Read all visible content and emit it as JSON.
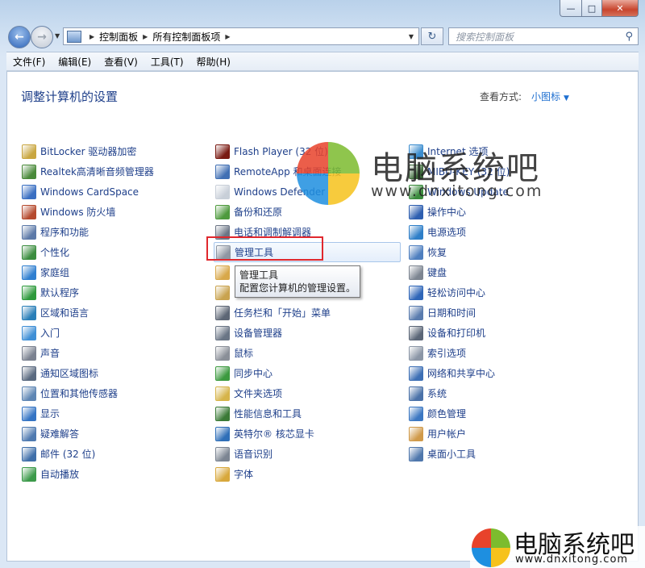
{
  "nav": {
    "address": [
      "控制面板",
      "所有控制面板项"
    ],
    "search_placeholder": "搜索控制面板"
  },
  "menu": [
    "文件(F)",
    "编辑(E)",
    "查看(V)",
    "工具(T)",
    "帮助(H)"
  ],
  "header": {
    "title": "调整计算机的设置",
    "view_by_label": "查看方式:",
    "view_by_value": "小图标"
  },
  "columns": [
    [
      {
        "label": "BitLocker 驱动器加密",
        "icon": "bitlocker-icon",
        "color": "#c9a640"
      },
      {
        "label": "Realtek高清晰音频管理器",
        "icon": "realtek-audio-icon",
        "color": "#4a8a3a"
      },
      {
        "label": "Windows CardSpace",
        "icon": "cardspace-icon",
        "color": "#3a6fc2"
      },
      {
        "label": "Windows 防火墙",
        "icon": "firewall-icon",
        "color": "#b54a2e"
      },
      {
        "label": "程序和功能",
        "icon": "programs-icon",
        "color": "#5d7aa8"
      },
      {
        "label": "个性化",
        "icon": "personalization-icon",
        "color": "#3b8d3f"
      },
      {
        "label": "家庭组",
        "icon": "homegroup-icon",
        "color": "#2f7fd0"
      },
      {
        "label": "默认程序",
        "icon": "default-programs-icon",
        "color": "#2e9a3c"
      },
      {
        "label": "区域和语言",
        "icon": "region-language-icon",
        "color": "#2a7fb8"
      },
      {
        "label": "入门",
        "icon": "getting-started-icon",
        "color": "#3f8fd6"
      },
      {
        "label": "声音",
        "icon": "sound-icon",
        "color": "#7b8290"
      },
      {
        "label": "通知区域图标",
        "icon": "notification-icon",
        "color": "#5a6a80"
      },
      {
        "label": "位置和其他传感器",
        "icon": "location-sensors-icon",
        "color": "#5e86b4"
      },
      {
        "label": "显示",
        "icon": "display-icon",
        "color": "#3474c4"
      },
      {
        "label": "疑难解答",
        "icon": "troubleshooting-icon",
        "color": "#4f7ab0"
      },
      {
        "label": "邮件 (32 位)",
        "icon": "mail-icon",
        "color": "#3f6fa9"
      },
      {
        "label": "自动播放",
        "icon": "autoplay-icon",
        "color": "#3c9a4a"
      }
    ],
    [
      {
        "label": "Flash Player (32 位)",
        "icon": "flash-icon",
        "color": "#7a1a12"
      },
      {
        "label": "RemoteApp 和桌面连接",
        "icon": "remoteapp-icon",
        "color": "#4170b4"
      },
      {
        "label": "Windows Defender",
        "icon": "defender-icon",
        "color": "#c8cfd8"
      },
      {
        "label": "备份和还原",
        "icon": "backup-icon",
        "color": "#4e9a3d"
      },
      {
        "label": "电话和调制解调器",
        "icon": "phone-modem-icon",
        "color": "#6b7585"
      },
      {
        "label": "管理工具",
        "icon": "admin-tools-icon",
        "color": "#8e96a2"
      },
      {
        "label": "",
        "icon": "hidden-item-icon",
        "color": "#d8a84a"
      },
      {
        "label": "",
        "icon": "hidden-item-icon-2",
        "color": "#c9a34f"
      },
      {
        "label": "任务栏和「开始」菜单",
        "icon": "taskbar-icon",
        "color": "#5d6675"
      },
      {
        "label": "设备管理器",
        "icon": "device-manager-icon",
        "color": "#6a7585"
      },
      {
        "label": "鼠标",
        "icon": "mouse-icon",
        "color": "#8a8f98"
      },
      {
        "label": "同步中心",
        "icon": "sync-center-icon",
        "color": "#3c9a3f"
      },
      {
        "label": "文件夹选项",
        "icon": "folder-options-icon",
        "color": "#d6b44a"
      },
      {
        "label": "性能信息和工具",
        "icon": "performance-icon",
        "color": "#3a7a36"
      },
      {
        "label": "英特尔® 核芯显卡",
        "icon": "intel-graphics-icon",
        "color": "#2f6fb8"
      },
      {
        "label": "语音识别",
        "icon": "speech-icon",
        "color": "#7c8592"
      },
      {
        "label": "字体",
        "icon": "fonts-icon",
        "color": "#d8a83c"
      }
    ],
    [
      {
        "label": "Internet 选项",
        "icon": "internet-options-icon",
        "color": "#3a8ccf"
      },
      {
        "label": "MIBU-KEY (32 位)",
        "icon": "mibu-key-icon",
        "color": "#3d6b3a"
      },
      {
        "label": "Windows Update",
        "icon": "windows-update-icon",
        "color": "#3b8c3d"
      },
      {
        "label": "操作中心",
        "icon": "action-center-icon",
        "color": "#2e5fb0"
      },
      {
        "label": "电源选项",
        "icon": "power-options-icon",
        "color": "#2f7fc8"
      },
      {
        "label": "恢复",
        "icon": "recovery-icon",
        "color": "#4f7fbf"
      },
      {
        "label": "键盘",
        "icon": "keyboard-icon",
        "color": "#7d8591"
      },
      {
        "label": "轻松访问中心",
        "icon": "ease-of-access-icon",
        "color": "#2f66b8"
      },
      {
        "label": "日期和时间",
        "icon": "date-time-icon",
        "color": "#5a7cae"
      },
      {
        "label": "设备和打印机",
        "icon": "devices-printers-icon",
        "color": "#5b6677"
      },
      {
        "label": "索引选项",
        "icon": "indexing-icon",
        "color": "#8b96a6"
      },
      {
        "label": "网络和共享中心",
        "icon": "network-icon",
        "color": "#3d6fb5"
      },
      {
        "label": "系统",
        "icon": "system-icon",
        "color": "#4b72a8"
      },
      {
        "label": "颜色管理",
        "icon": "color-management-icon",
        "color": "#3c78c2"
      },
      {
        "label": "用户帐户",
        "icon": "user-accounts-icon",
        "color": "#d09a4a"
      },
      {
        "label": "桌面小工具",
        "icon": "gadgets-icon",
        "color": "#4f77ac"
      }
    ]
  ],
  "tooltip": {
    "title": "管理工具",
    "desc": "配置您计算机的管理设置。"
  },
  "watermark": {
    "name": "电脑系统吧",
    "url": "www.dnxitong.com"
  }
}
